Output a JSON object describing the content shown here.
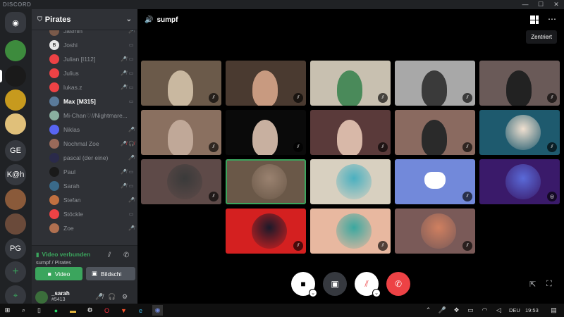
{
  "window": {
    "app_logo": "DISCORD",
    "controls": [
      "—",
      "☐",
      "✕"
    ]
  },
  "guilds": [
    {
      "label": "",
      "icon": "discord-home-icon",
      "color": "#36393f"
    },
    {
      "label": "",
      "icon": "pepe-avatar",
      "color": "#3d8b3d"
    },
    {
      "label": "",
      "icon": "ship-avatar",
      "color": "#1a1a1a"
    },
    {
      "label": "",
      "icon": "sun-avatar",
      "color": "#c79a1e"
    },
    {
      "label": "",
      "icon": "cake-avatar",
      "color": "#e0c07a"
    },
    {
      "label": "GE",
      "icon": "",
      "color": "#36393f"
    },
    {
      "label": "K@h",
      "icon": "",
      "color": "#36393f"
    },
    {
      "label": "",
      "icon": "scene-avatar",
      "color": "#8a5a3a"
    },
    {
      "label": "",
      "icon": "people-avatar",
      "color": "#6a4a3a"
    },
    {
      "label": "PG",
      "icon": "",
      "color": "#36393f"
    },
    {
      "label": "+",
      "icon": "add-server-icon",
      "color": "#36393f"
    },
    {
      "label": "⌖",
      "icon": "explore-icon",
      "color": "#36393f"
    }
  ],
  "server": {
    "name": "Pirates"
  },
  "members": [
    {
      "name": "Jasmin",
      "color": "#7a5a4a",
      "initial": "",
      "icons": [
        "🎤̸"
      ]
    },
    {
      "name": "Joshi",
      "color": "#e8e8e8",
      "initial": "B",
      "icons": [
        "▭"
      ]
    },
    {
      "name": "Julian [I112]",
      "color": "#ed4245",
      "initial": "",
      "icons": [
        "🎤̸",
        "▭"
      ]
    },
    {
      "name": "Julius",
      "color": "#ed4245",
      "initial": "",
      "icons": [
        "🎤̸",
        "▭"
      ]
    },
    {
      "name": "lukas.z",
      "color": "#ed4245",
      "initial": "",
      "icons": [
        "🎤̸",
        "▭"
      ]
    },
    {
      "name": "Max [M315]",
      "color": "#5a7a9a",
      "initial": "",
      "icons": [
        "▭"
      ],
      "active": true
    },
    {
      "name": "Mi-Chan♡//Nightmare...",
      "color": "#8ab0a0",
      "initial": "",
      "icons": []
    },
    {
      "name": "Niklas",
      "color": "#5865f2",
      "initial": "",
      "icons": [
        "🎤̸"
      ]
    },
    {
      "name": "Nochmal Zoe",
      "color": "#9a6a5a",
      "initial": "",
      "icons": [
        "🎤̸",
        "🎧̸"
      ],
      "red": true
    },
    {
      "name": "pascal (der eine)",
      "color": "#2a2a4a",
      "initial": "",
      "icons": [
        "🎤̸"
      ]
    },
    {
      "name": "Paul",
      "color": "#1a1a1a",
      "initial": "",
      "icons": [
        "🎤̸",
        "▭"
      ]
    },
    {
      "name": "Sarah",
      "color": "#3a6a8a",
      "initial": "",
      "icons": [
        "🎤̸",
        "▭"
      ]
    },
    {
      "name": "Stefan",
      "color": "#c07040",
      "initial": "",
      "icons": [
        "🎤̸"
      ]
    },
    {
      "name": "Stöckle",
      "color": "#ed4245",
      "initial": "",
      "icons": [
        "▭"
      ]
    },
    {
      "name": "Zoe",
      "color": "#b07050",
      "initial": "",
      "icons": [
        "🎤̸"
      ]
    }
  ],
  "voice": {
    "status": "Video verbunden",
    "channel": "sumpf / Pirates",
    "video_label": "Video",
    "screen_label": "Bildschi"
  },
  "user": {
    "name": "_sarah",
    "tag": "#5413"
  },
  "channel": {
    "name": "sumpf",
    "tooltip": "Zentriert"
  },
  "tiles": [
    {
      "kind": "camera",
      "bg": "#6b5a4a",
      "accent": "#c9b8a0",
      "muted": true
    },
    {
      "kind": "camera",
      "bg": "#4a3a30",
      "accent": "#c89a80",
      "muted": true
    },
    {
      "kind": "camera",
      "bg": "#c8c0b0",
      "accent": "#4a8a5a",
      "muted": true
    },
    {
      "kind": "camera",
      "bg": "#a8a8a8",
      "accent": "#3a3a3a",
      "muted": true
    },
    {
      "kind": "camera",
      "bg": "#6a5a58",
      "accent": "#222222",
      "muted": true
    },
    {
      "kind": "camera",
      "bg": "#8a7060",
      "accent": "#c0a898",
      "muted": true
    },
    {
      "kind": "camera",
      "bg": "#0a0a0a",
      "accent": "#c8b0a0",
      "muted": true
    },
    {
      "kind": "camera",
      "bg": "#5a3a3a",
      "accent": "#d8b8a8",
      "muted": true
    },
    {
      "kind": "camera",
      "bg": "#8a6a60",
      "accent": "#2a2a2a",
      "muted": true
    },
    {
      "kind": "avatar",
      "bg": "#1e5a6e",
      "accent": "#f0e0d0",
      "muted": true
    },
    {
      "kind": "avatar",
      "bg": "#5e4a48",
      "accent": "#3a3a3a",
      "muted": true
    },
    {
      "kind": "avatar",
      "bg": "#6a5848",
      "accent": "#9a8270",
      "muted": false,
      "speaking": true
    },
    {
      "kind": "avatar",
      "bg": "#d8d0c0",
      "accent": "#4ab0c0",
      "muted": false
    },
    {
      "kind": "discord",
      "bg": "#7289da",
      "accent": "#ffffff",
      "muted": true
    },
    {
      "kind": "avatar",
      "bg": "#3a1a6a",
      "accent": "#5a6ad8",
      "muted": true,
      "deafened": true
    },
    {
      "kind": "avatar",
      "bg": "#d42020",
      "accent": "#1a1a2a",
      "muted": true
    },
    {
      "kind": "avatar",
      "bg": "#e8b8a0",
      "accent": "#3aa8a0",
      "muted": true
    },
    {
      "kind": "avatar",
      "bg": "#7a5a58",
      "accent": "#d08060",
      "muted": true
    }
  ],
  "taskbar": {
    "lang": "DEU",
    "time": "19:53"
  }
}
